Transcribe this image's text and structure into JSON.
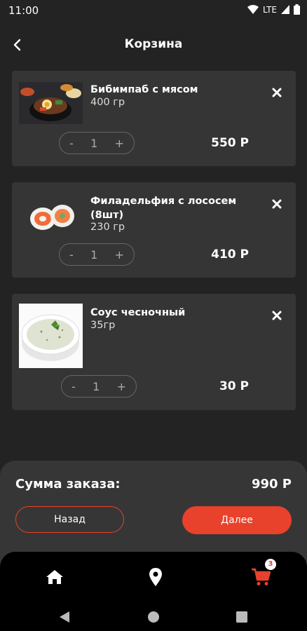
{
  "status": {
    "time": "11:00",
    "network": "LTE"
  },
  "header": {
    "title": "Корзина"
  },
  "cart": {
    "items": [
      {
        "name": "Бибимпаб с мясом",
        "weight": "400 гр",
        "qty": "1",
        "price": "550 Р"
      },
      {
        "name": "Филадельфия с лососем (8шт)",
        "weight": "230 гр",
        "qty": "1",
        "price": "410 Р"
      },
      {
        "name": "Соус чесночный",
        "weight": "35гр",
        "qty": "1",
        "price": "30 Р"
      }
    ],
    "stepper": {
      "minus": "-",
      "plus": "+"
    }
  },
  "summary": {
    "label": "Сумма заказа:",
    "total": "990 Р",
    "back_label": "Назад",
    "next_label": "Далее"
  },
  "nav": {
    "cart_badge": "3"
  },
  "colors": {
    "accent": "#e8412c",
    "card": "#353535",
    "background": "#232323"
  },
  "icons": [
    "back-arrow-icon",
    "remove-x-icon",
    "home-icon",
    "location-pin-icon",
    "cart-icon"
  ]
}
